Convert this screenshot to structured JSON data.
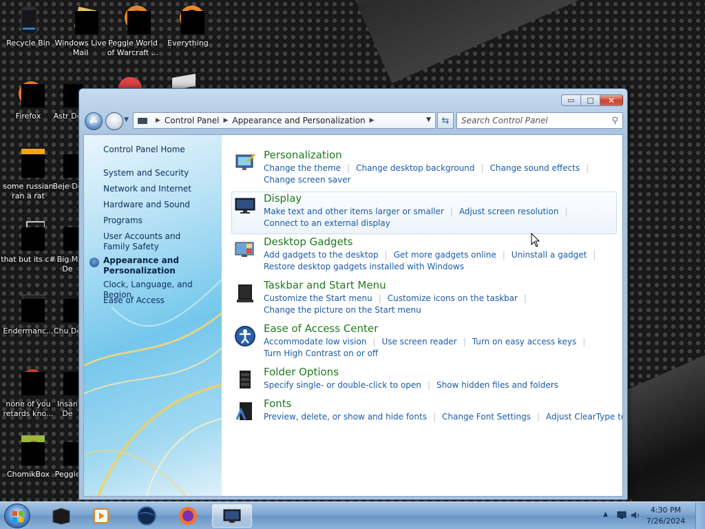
{
  "desktop": {
    "icons": [
      {
        "label": "Recycle Bin"
      },
      {
        "label": "Windows Live Mail"
      },
      {
        "label": "Peggle World of Warcraft ..."
      },
      {
        "label": "Everything"
      },
      {
        "label": "Firefox"
      },
      {
        "label": "Astr De"
      },
      {
        "label": "some russian ran a rat"
      },
      {
        "label": "Beje De"
      },
      {
        "label": "that but its c#"
      },
      {
        "label": "Big M De"
      },
      {
        "label": "Endermanc..."
      },
      {
        "label": "Chu De"
      },
      {
        "label": "none of you retards kno..."
      },
      {
        "label": "Insan De"
      },
      {
        "label": "ChomikBox"
      },
      {
        "label": "Peggle"
      }
    ]
  },
  "window": {
    "caption": {
      "minimize": "▭",
      "maximize": "□",
      "close": "✕"
    },
    "address": {
      "crumbs": [
        "Control Panel",
        "Appearance and Personalization"
      ]
    },
    "search": {
      "placeholder": "Search Control Panel"
    },
    "left_pane": {
      "home": "Control Panel Home",
      "items": [
        "System and Security",
        "Network and Internet",
        "Hardware and Sound",
        "Programs",
        "User Accounts and Family Safety",
        "Appearance and Personalization",
        "Clock, Language, and Region",
        "Ease of Access"
      ],
      "current_index": 5
    },
    "sections": [
      {
        "title": "Personalization",
        "icon": "personalization-icon",
        "links": [
          "Change the theme",
          "Change desktop background",
          "Change sound effects",
          "Change screen saver"
        ]
      },
      {
        "title": "Display",
        "icon": "display-icon",
        "links": [
          "Make text and other items larger or smaller",
          "Adjust screen resolution",
          "Connect to an external display"
        ]
      },
      {
        "title": "Desktop Gadgets",
        "icon": "desktop-gadgets-icon",
        "links": [
          "Add gadgets to the desktop",
          "Get more gadgets online",
          "Uninstall a gadget",
          "Restore desktop gadgets installed with Windows"
        ]
      },
      {
        "title": "Taskbar and Start Menu",
        "icon": "taskbar-icon",
        "links": [
          "Customize the Start menu",
          "Customize icons on the taskbar",
          "Change the picture on the Start menu"
        ]
      },
      {
        "title": "Ease of Access Center",
        "icon": "ease-of-access-icon",
        "links": [
          "Accommodate low vision",
          "Use screen reader",
          "Turn on easy access keys",
          "Turn High Contrast on or off"
        ]
      },
      {
        "title": "Folder Options",
        "icon": "folder-options-icon",
        "links": [
          "Specify single- or double-click to open",
          "Show hidden files and folders"
        ]
      },
      {
        "title": "Fonts",
        "icon": "fonts-icon",
        "links": [
          "Preview, delete, or show and hide fonts",
          "Change Font Settings",
          "Adjust ClearType text"
        ]
      }
    ]
  },
  "taskbar": {
    "buttons": [
      "media-player-icon",
      "wmp-icon",
      "globe-icon",
      "firefox-icon",
      "control-panel-icon"
    ],
    "clock": {
      "time": "4:30 PM",
      "date": "7/26/2024"
    }
  },
  "colors": {
    "link": "#1a5aa8",
    "heading": "#1e7a1e",
    "nav": "#0b2c5a"
  }
}
